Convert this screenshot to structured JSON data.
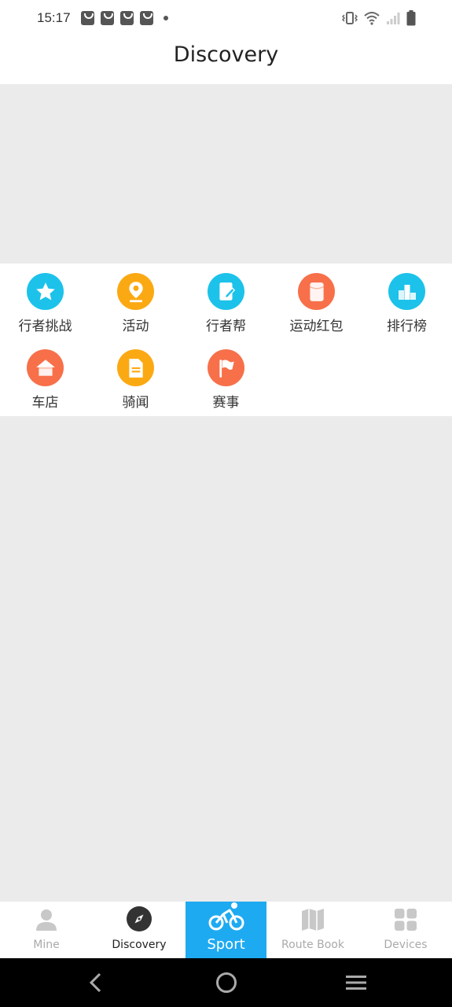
{
  "status_bar": {
    "time": "15:17",
    "notification_icons": [
      "shopping-bag-icon",
      "shopping-bag-icon",
      "shopping-bag-icon",
      "shopping-bag-icon"
    ],
    "system_icons": [
      "vibrate-icon",
      "wifi-icon",
      "signal-icon",
      "battery-icon"
    ]
  },
  "header": {
    "title": "Discovery"
  },
  "colors": {
    "cyan": "#1cc2ea",
    "orange": "#fba913",
    "coral": "#f7704a",
    "sport_blue": "#1eaaf1",
    "tab_inactive": "#aaaaaa"
  },
  "grid": {
    "items": [
      {
        "label": "行者挑战",
        "icon": "star-icon",
        "color": "#1cc2ea"
      },
      {
        "label": "活动",
        "icon": "location-pin-icon",
        "color": "#fba913"
      },
      {
        "label": "行者帮",
        "icon": "note-edit-icon",
        "color": "#1cc2ea"
      },
      {
        "label": "运动红包",
        "icon": "red-envelope-icon",
        "color": "#f7704a"
      },
      {
        "label": "排行榜",
        "icon": "ranking-bars-icon",
        "color": "#1cc2ea"
      },
      {
        "label": "车店",
        "icon": "shop-house-icon",
        "color": "#f7704a"
      },
      {
        "label": "骑闻",
        "icon": "news-document-icon",
        "color": "#fba913"
      },
      {
        "label": "赛事",
        "icon": "flag-icon",
        "color": "#f7704a"
      }
    ]
  },
  "tabbar": {
    "tabs": [
      {
        "label": "Mine",
        "icon": "person-icon",
        "state": "inactive"
      },
      {
        "label": "Discovery",
        "icon": "compass-icon",
        "state": "active"
      },
      {
        "label": "Sport",
        "icon": "cyclist-icon",
        "state": "highlight"
      },
      {
        "label": "Route Book",
        "icon": "map-icon",
        "state": "inactive"
      },
      {
        "label": "Devices",
        "icon": "grid-squares-icon",
        "state": "inactive"
      }
    ]
  },
  "navigation_bar": {
    "buttons": [
      "back-icon",
      "home-icon",
      "menu-icon"
    ]
  }
}
